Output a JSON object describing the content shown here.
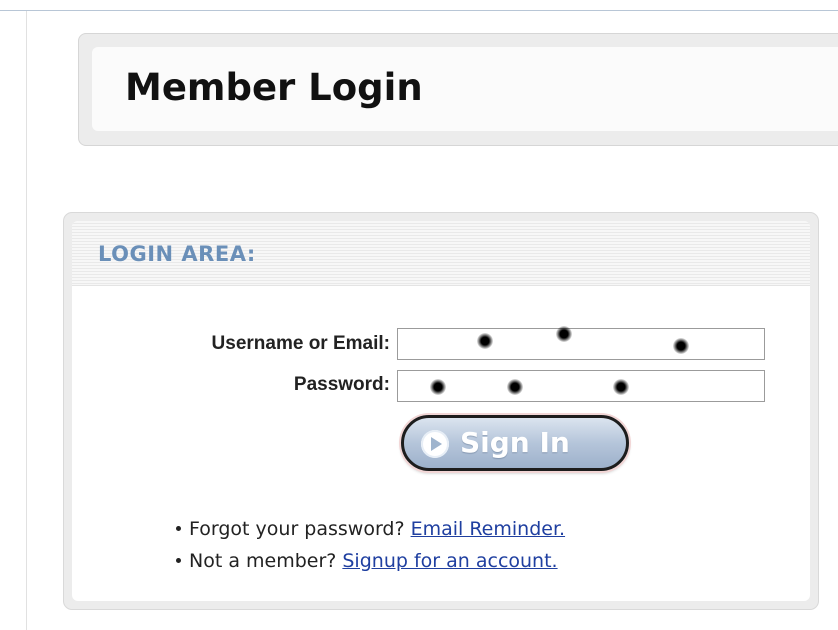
{
  "header": {
    "title": "Member Login"
  },
  "login_area": {
    "heading": "LOGIN AREA:",
    "username_label": "Username or Email:",
    "password_label": "Password:",
    "username_value": "",
    "password_value": "",
    "username_masked": true,
    "password_masked": true,
    "signin_label": "Sign In",
    "signin_icon": "play-circle-icon"
  },
  "help": {
    "forgot_text": "Forgot your password?",
    "forgot_link": "Email Reminder.",
    "signup_text": "Not a member?",
    "signup_link": "Signup for an account."
  },
  "colors": {
    "heading_accent": "#6a8fb8",
    "link": "#1f3fa0",
    "button_fill": "#b5c5da"
  }
}
